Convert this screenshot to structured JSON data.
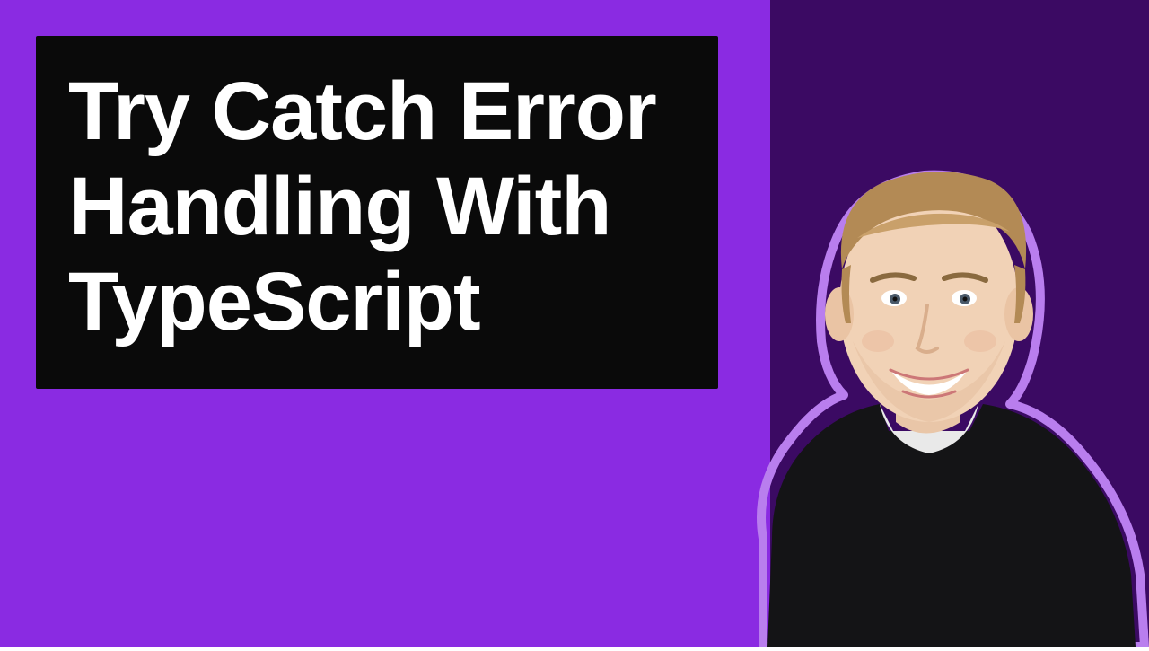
{
  "colors": {
    "bg_left": "#8a2be2",
    "bg_right": "#3b0a63",
    "card_bg": "#0a0a0a",
    "text": "#ffffff",
    "outline": "#b97eee"
  },
  "title_card": {
    "line1": "Try Catch Error",
    "line2": "Handling With",
    "line3": "TypeScript"
  },
  "person": {
    "description": "presenter-portrait"
  }
}
